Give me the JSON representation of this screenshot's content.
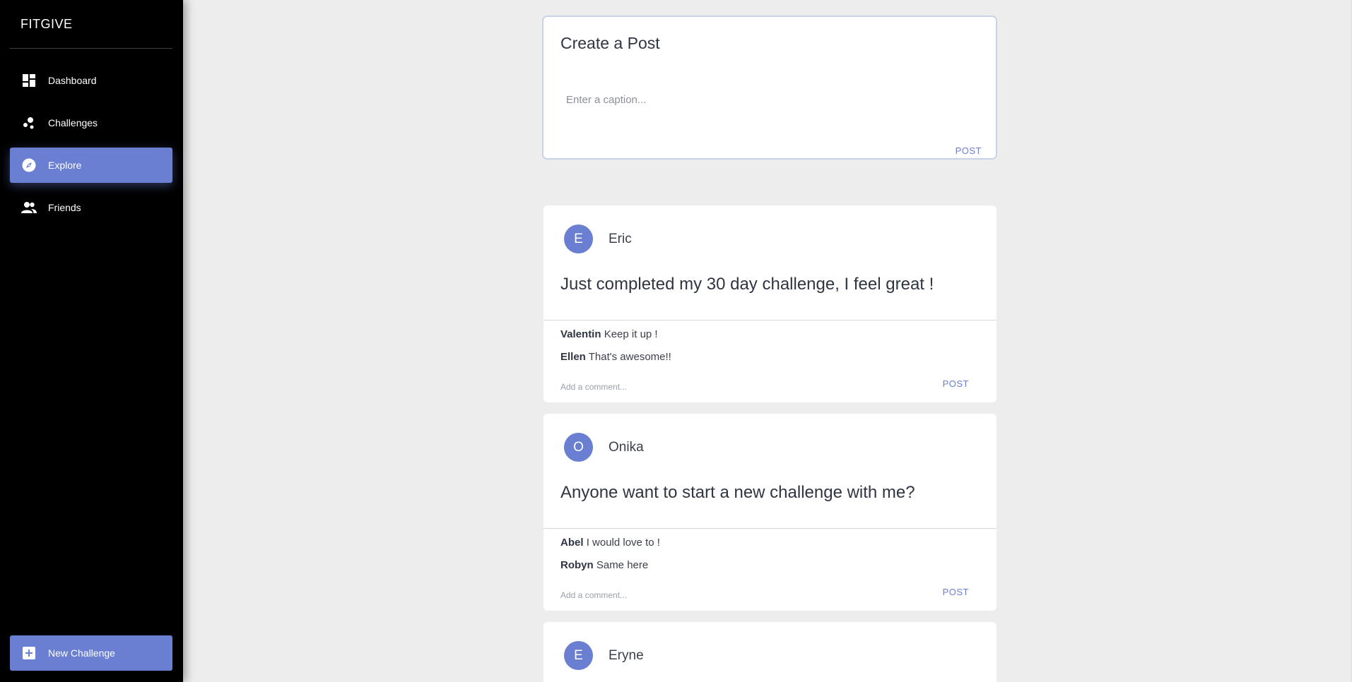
{
  "sidebar": {
    "brand": "FITGIVE",
    "items": [
      {
        "label": "Dashboard",
        "icon": "dashboard-icon"
      },
      {
        "label": "Challenges",
        "icon": "challenges-icon"
      },
      {
        "label": "Explore",
        "icon": "compass-icon",
        "active": true
      },
      {
        "label": "Friends",
        "icon": "people-icon"
      }
    ],
    "new_challenge": {
      "label": "New Challenge",
      "icon": "add-box-icon"
    }
  },
  "create_post": {
    "title": "Create a Post",
    "caption_placeholder": "Enter a caption...",
    "post_label": "POST"
  },
  "posts": [
    {
      "initial": "E",
      "author": "Eric",
      "text": "Just completed my 30 day challenge, I feel great !",
      "comments": [
        {
          "user": "Valentin",
          "text": "Keep it up !"
        },
        {
          "user": "Ellen",
          "text": "That's awesome!!"
        }
      ],
      "comment_placeholder": "Add a comment...",
      "post_label": "POST"
    },
    {
      "initial": "O",
      "author": "Onika",
      "text": "Anyone want to start a new challenge with me?",
      "comments": [
        {
          "user": "Abel",
          "text": "I would love to !"
        },
        {
          "user": "Robyn",
          "text": "Same here"
        }
      ],
      "comment_placeholder": "Add a comment...",
      "post_label": "POST"
    },
    {
      "initial": "E",
      "author": "Eryne"
    }
  ],
  "colors": {
    "accent": "#6a7fd1",
    "sidebar_bg": "#000000",
    "page_bg": "#ededed"
  }
}
